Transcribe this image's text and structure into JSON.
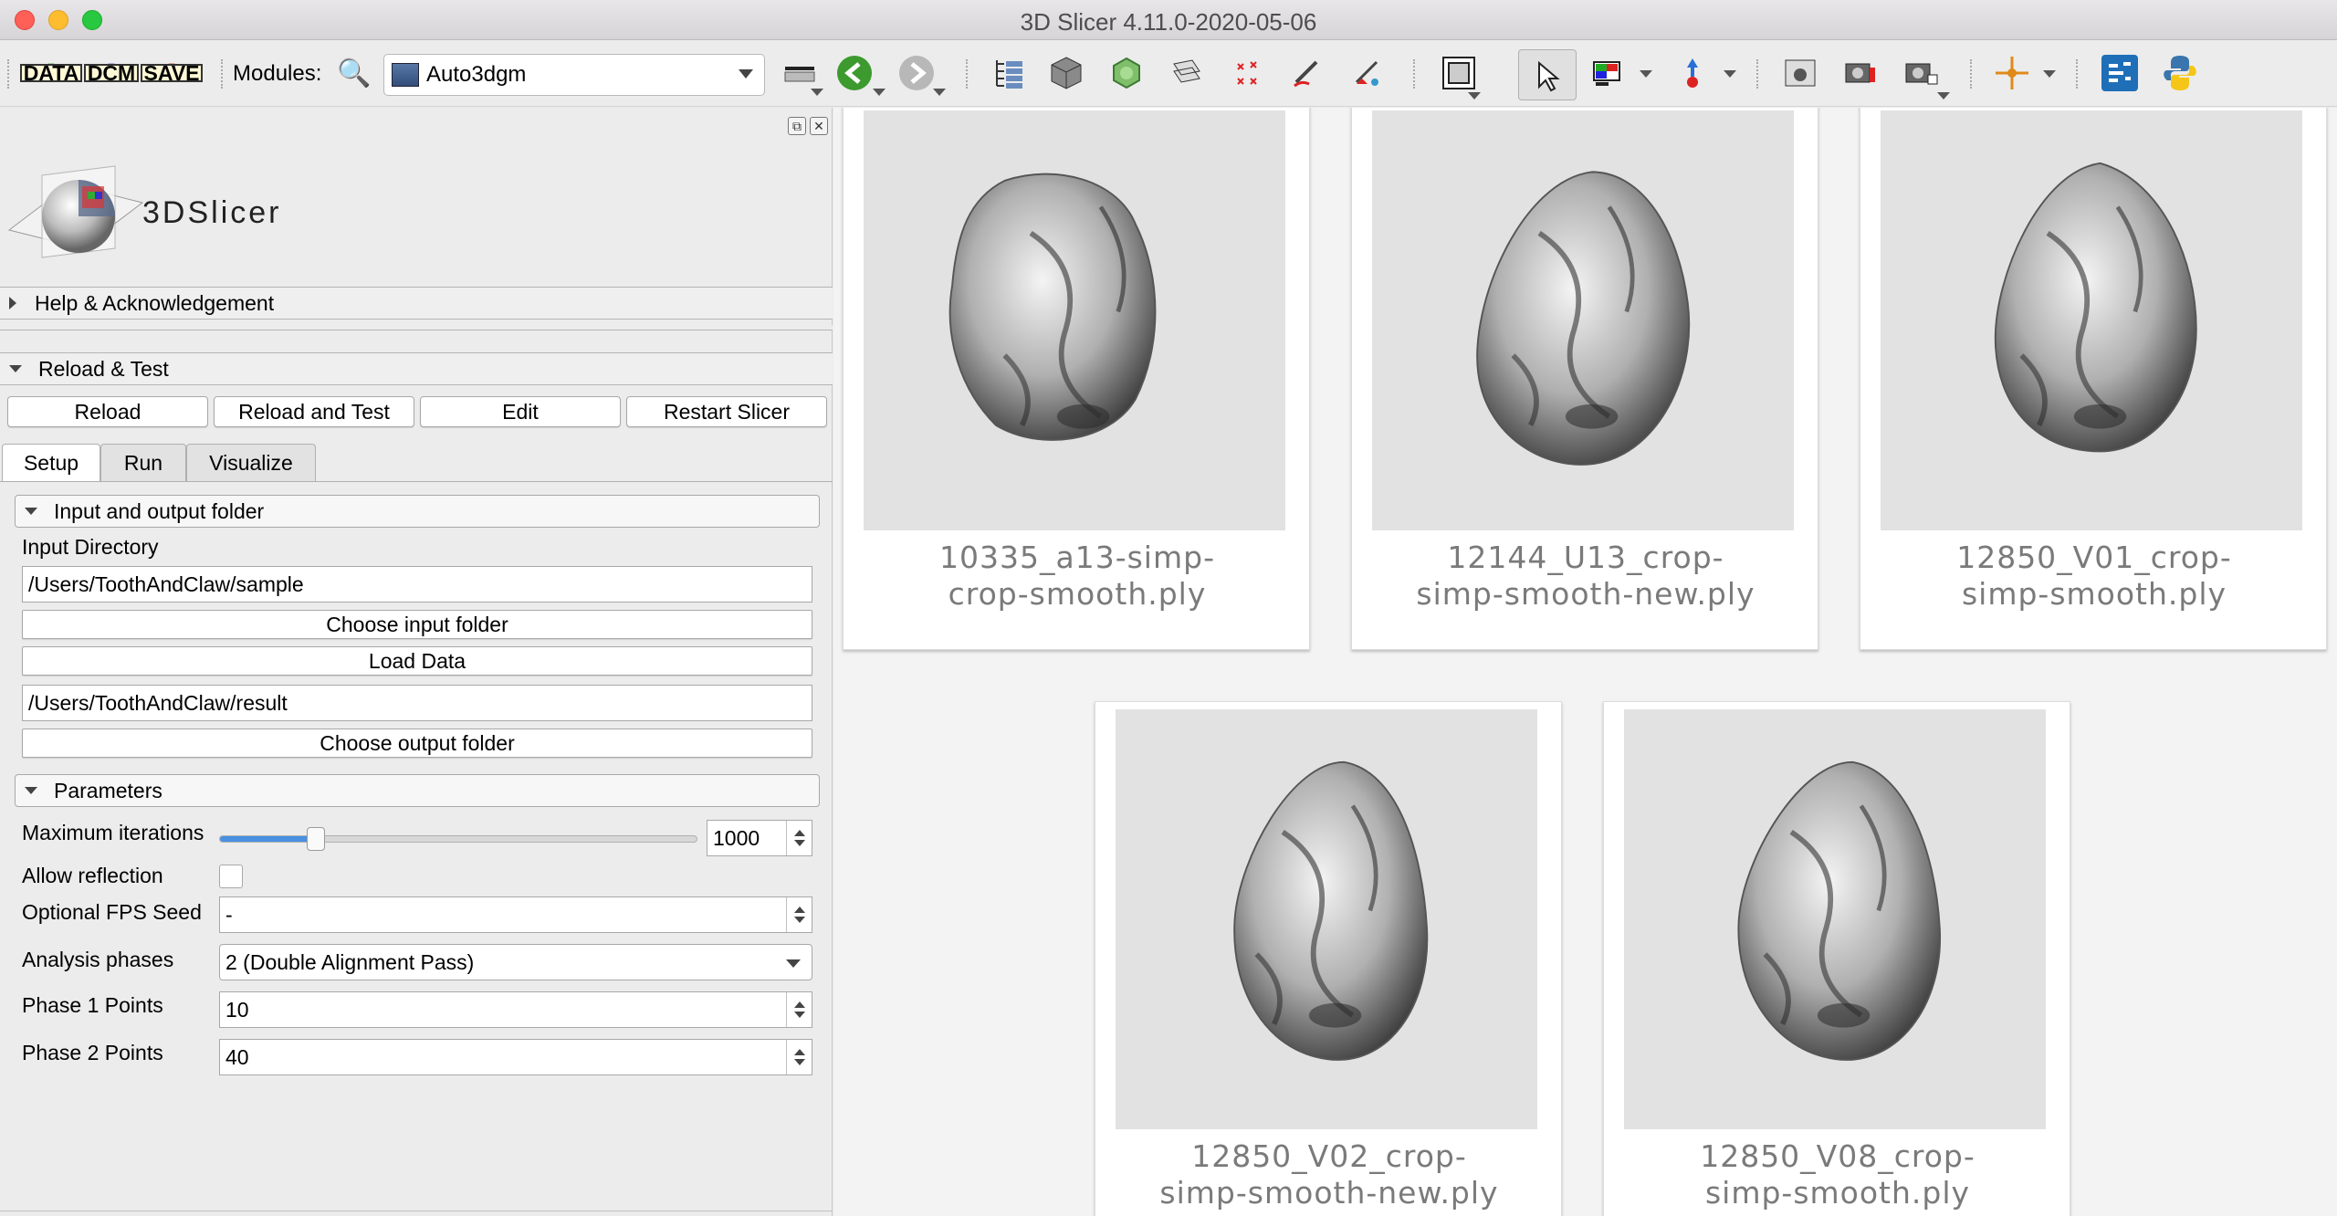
{
  "window": {
    "title": "3D Slicer 4.11.0-2020-05-06"
  },
  "toolbar": {
    "data_label": "DATA",
    "dcm_label": "DCM",
    "save_label": "SAVE",
    "modules_label": "Modules:",
    "module_selected": "Auto3dgm",
    "icons": [
      "layout-icon",
      "back-icon",
      "forward-icon",
      "data-module-icon",
      "volumes-icon",
      "models-icon",
      "transforms-icon",
      "markups-icon",
      "segment-editor-icon",
      "annotation-icon",
      "screenshot-icon",
      "mouse-pointer-icon",
      "crosshair-icon",
      "extension-manager-icon",
      "python-icon"
    ]
  },
  "panel": {
    "logo_text": "3DSlicer",
    "help_section": "Help & Acknowledgement",
    "reload_section": "Reload & Test",
    "buttons": {
      "reload": "Reload",
      "reload_test": "Reload and Test",
      "edit": "Edit",
      "restart": "Restart Slicer"
    },
    "tabs": [
      "Setup",
      "Run",
      "Visualize"
    ],
    "io_section": "Input and output folder",
    "input_dir_label": "Input Directory",
    "input_dir_value": "/Users/ToothAndClaw/sample",
    "choose_input": "Choose input folder",
    "load_data": "Load Data",
    "output_dir_value": "/Users/ToothAndClaw/result",
    "choose_output": "Choose output folder",
    "params_section": "Parameters",
    "max_iter_label": "Maximum iterations",
    "max_iter_value": "1000",
    "max_iter_slider_fraction": 0.2,
    "allow_reflection_label": "Allow reflection",
    "allow_reflection_checked": false,
    "fps_seed_label": "Optional FPS Seed",
    "fps_seed_value": "-",
    "phases_label": "Analysis phases",
    "phases_value": "2 (Double Alignment Pass)",
    "phase1_label": "Phase 1 Points",
    "phase1_value": "10",
    "phase2_label": "Phase 2 Points",
    "phase2_value": "40"
  },
  "gallery": {
    "items": [
      {
        "line1": "10335_a13-simp-",
        "line2": "crop-smooth.ply"
      },
      {
        "line1": "12144_U13_crop-",
        "line2": "simp-smooth-new.ply"
      },
      {
        "line1": "12850_V01_crop-",
        "line2": "simp-smooth.ply"
      },
      {
        "line1": "12850_V02_crop-",
        "line2": "simp-smooth-new.ply"
      },
      {
        "line1": "12850_V08_crop-",
        "line2": "simp-smooth.ply"
      }
    ]
  },
  "colors": {
    "accent": "#4a90e2",
    "close": "#fe5f57",
    "minimize": "#febc2e",
    "maximize": "#28c840"
  }
}
